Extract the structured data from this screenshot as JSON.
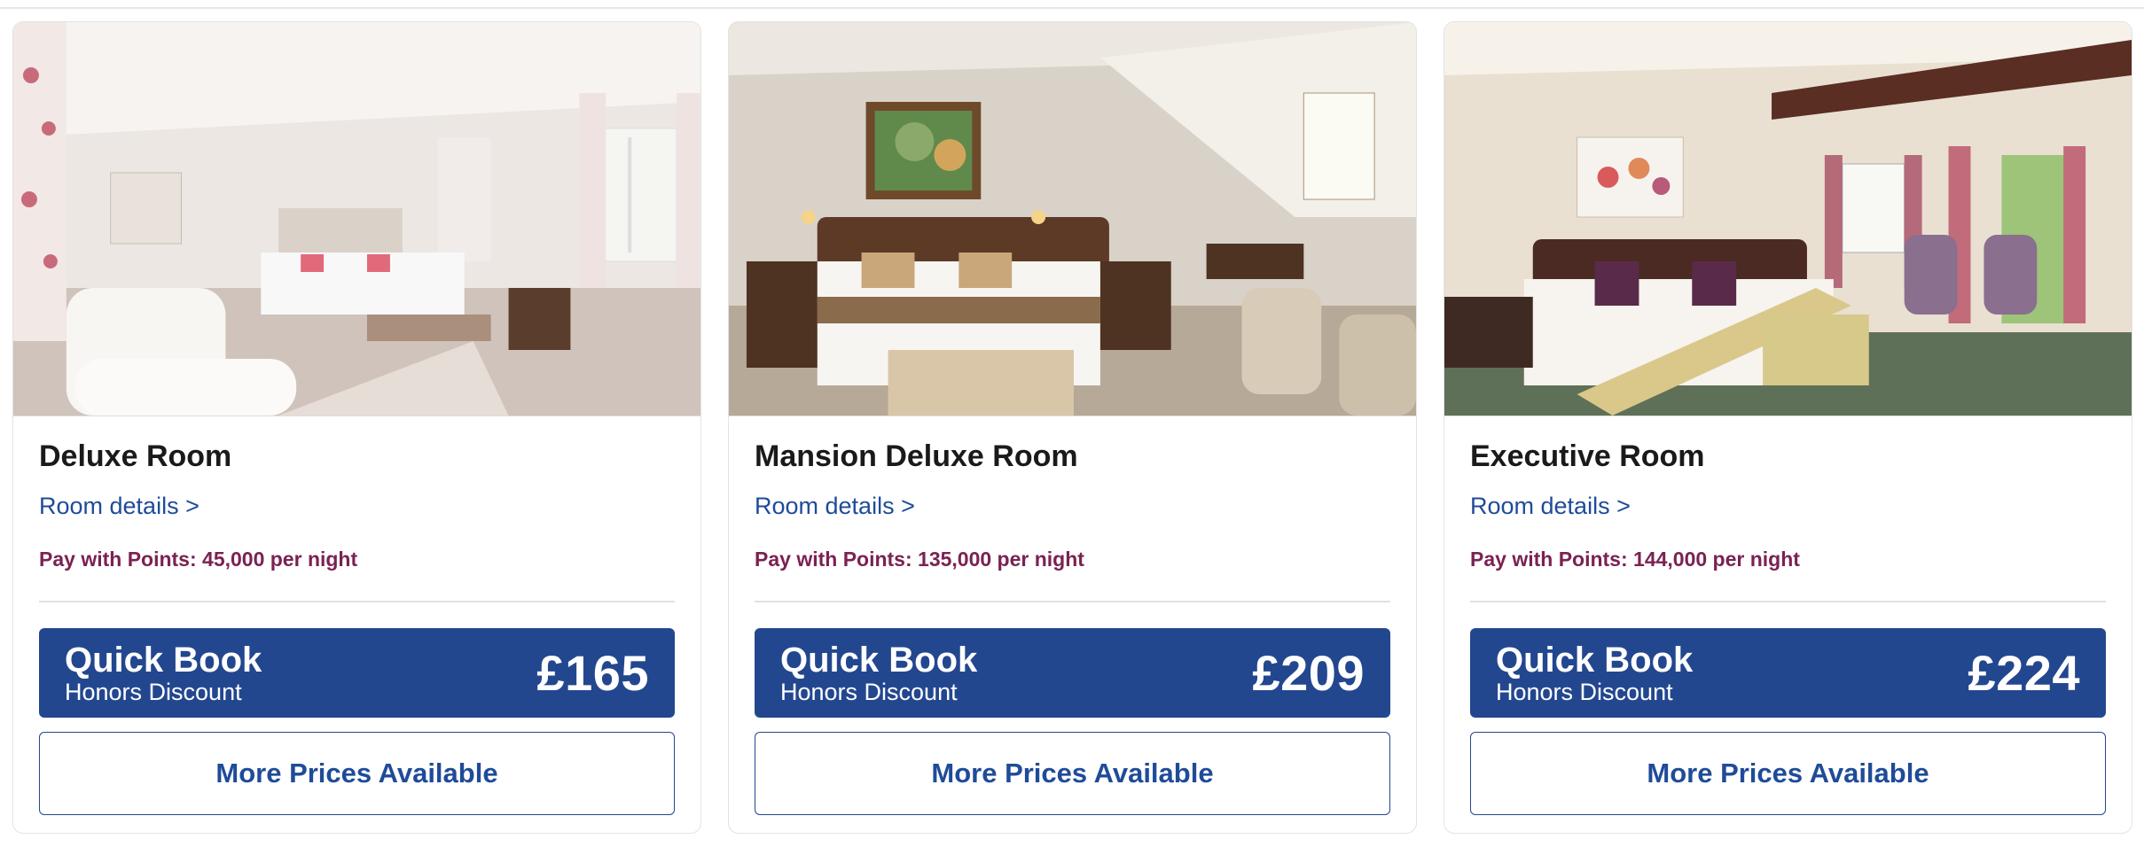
{
  "rooms": [
    {
      "name": "Deluxe Room",
      "details_link": "Room details >",
      "points": "Pay with Points: 45,000 per night",
      "quick_book": {
        "title": "Quick Book",
        "subtitle": "Honors Discount",
        "price": "£165"
      },
      "more_prices": "More Prices Available",
      "photo_icon": "bedroom-photo"
    },
    {
      "name": "Mansion Deluxe Room",
      "details_link": "Room details >",
      "points": "Pay with Points: 135,000 per night",
      "quick_book": {
        "title": "Quick Book",
        "subtitle": "Honors Discount",
        "price": "£209"
      },
      "more_prices": "More Prices Available",
      "photo_icon": "bedroom-photo"
    },
    {
      "name": "Executive Room",
      "details_link": "Room details >",
      "points": "Pay with Points: 144,000 per night",
      "quick_book": {
        "title": "Quick Book",
        "subtitle": "Honors Discount",
        "price": "£224"
      },
      "more_prices": "More Prices Available",
      "photo_icon": "bedroom-photo"
    }
  ],
  "colors": {
    "brand_blue": "#23478f",
    "link_blue": "#1f4b99",
    "points_purple": "#7a2252"
  }
}
